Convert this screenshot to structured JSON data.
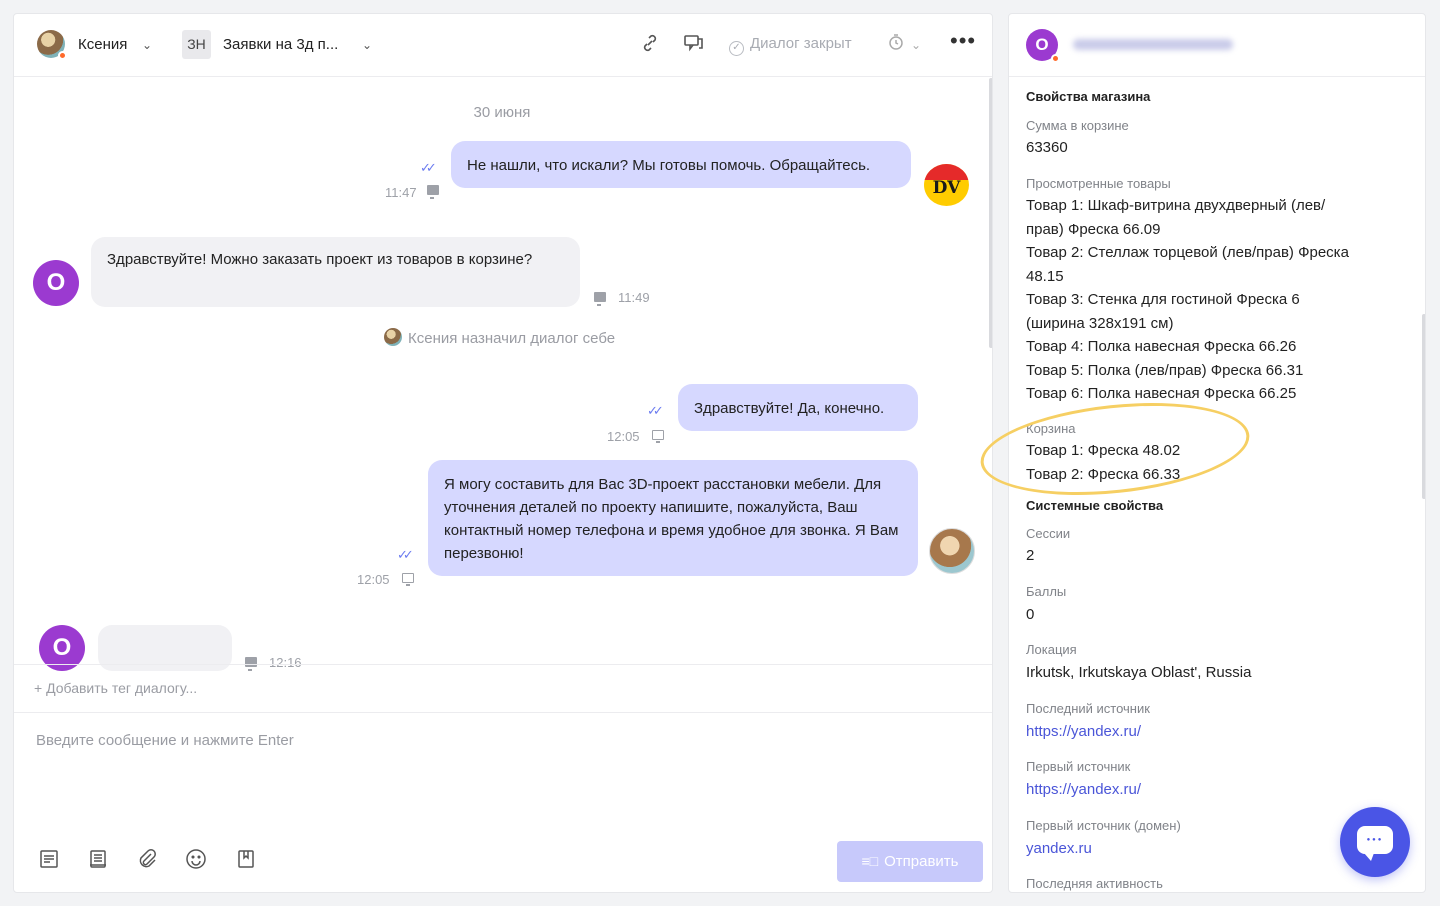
{
  "chat": {
    "header": {
      "operator_name": "Ксения",
      "channel_badge": "ЗН",
      "channel_name": "Заявки на 3д п...",
      "dialog_status": "Диалог закрыт",
      "more": "•••"
    },
    "date_separator": "30 июня",
    "messages": [
      {
        "direction": "out",
        "text": "Не нашли, что искали? Мы готовы помочь. Обращайтесь.",
        "time": "11:47",
        "avatar_text": "DV"
      },
      {
        "direction": "in",
        "text": "Здравствуйте! Можно заказать проект из товаров в корзине?",
        "time": "11:49",
        "avatar_text": "О"
      },
      {
        "direction": "out",
        "text": "Здравствуйте! Да, конечно.",
        "time": "12:05"
      },
      {
        "direction": "out",
        "text": "Я могу составить для Вас 3D-проект расстановки мебели. Для уточнения деталей по проекту напишите, пожалуйста, Ваш контактный номер телефона и время удобное для звонка. Я Вам перезвоню!",
        "time": "12:05"
      },
      {
        "direction": "in",
        "text": "",
        "time": "12:16",
        "avatar_text": "О"
      }
    ],
    "system_note": "Ксения назначил диалог себе",
    "tag_placeholder": "+ Добавить тег диалогу...",
    "input_placeholder": "Введите сообщение и нажмите Enter",
    "send_label": "Отправить"
  },
  "right": {
    "avatar_text": "О",
    "store_section": "Свойства магазина",
    "cart_sum_label": "Сумма в корзине",
    "cart_sum_value": "63360",
    "viewed_label": "Просмотренные товары",
    "viewed_text": "Товар 1: Шкаф-витрина двухдверный (лев/прав) Фреска 66.09\nТовар 2: Стеллаж торцевой (лев/прав) Фреска 48.15\nТовар 3: Стенка для гостиной Фреска 6 (ширина 328x191 см)\nТовар 4: Полка навесная Фреска 66.26\nТовар 5: Полка (лев/прав) Фреска 66.31\nТовар 6: Полка навесная Фреска 66.25",
    "basket_label": "Корзина",
    "basket_item1": "Товар 1: Фреска 48.02",
    "basket_item2": "Товар 2: Фреска 66.33",
    "system_section": "Системные свойства",
    "sessions_label": "Сессии",
    "sessions_value": "2",
    "points_label": "Баллы",
    "points_value": "0",
    "location_label": "Локация",
    "location_value": "Irkutsk, Irkutskaya Oblast', Russia",
    "last_source_label": "Последний источник",
    "last_source_value": "https://yandex.ru/",
    "first_source_label": "Первый источник",
    "first_source_value": "https://yandex.ru/",
    "first_domain_label": "Первый источник (домен)",
    "first_domain_value": "yandex.ru",
    "last_activity_label": "Последняя активность"
  },
  "colors": {
    "accent": "#4a55e6",
    "bubble_out": "#d6d8ff",
    "bubble_in": "#f1f1f4",
    "avatar": "#9b3ad0",
    "highlight": "#f6cf63",
    "online_dot": "#ff6a2b"
  },
  "icons": [
    "link-icon",
    "chat-transfer-icon",
    "check-circle-icon",
    "clock-icon",
    "more-icon",
    "template-icon",
    "notes-icon",
    "attach-icon",
    "emoji-icon",
    "bookmark-icon",
    "send-icon",
    "chat-widget-icon"
  ]
}
